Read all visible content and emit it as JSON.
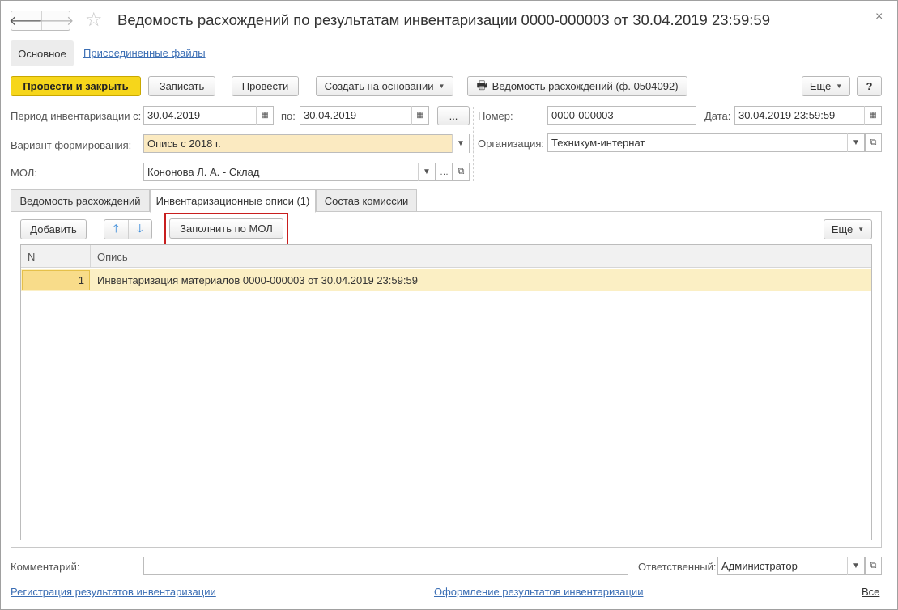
{
  "window": {
    "title": "Ведомость расхождений по результатам инвентаризации 0000-000003 от 30.04.2019 23:59:59",
    "close_glyph": "×"
  },
  "nav": {
    "back_glyph": "🡐",
    "forward_glyph": "🡒",
    "favorite_glyph": "☆"
  },
  "sections": {
    "main": "Основное",
    "files": "Присоединенные файлы"
  },
  "toolbar": {
    "post_close": "Провести и закрыть",
    "save": "Записать",
    "post": "Провести",
    "create_based": "Создать на основании",
    "print_icon": "🖶",
    "print_report": "Ведомость расхождений (ф. 0504092)",
    "more": "Еще",
    "help": "?"
  },
  "form": {
    "period_label": "Период инвентаризации с:",
    "period_from": "30.04.2019",
    "to_label": "по:",
    "period_to": "30.04.2019",
    "ellipsis": "...",
    "number_label": "Номер:",
    "number": "0000-000003",
    "date_label": "Дата:",
    "date": "30.04.2019 23:59:59",
    "variant_label": "Вариант формирования:",
    "variant": "Опись с 2018 г.",
    "org_label": "Организация:",
    "org": "Техникум-интернат",
    "mol_label": "МОЛ:",
    "mol": "Кононова Л. А. - Склад"
  },
  "tabs": [
    {
      "label": "Ведомость расхождений"
    },
    {
      "label": "Инвентаризационные описи (1)"
    },
    {
      "label": "Состав комиссии"
    }
  ],
  "tab_toolbar": {
    "add": "Добавить",
    "up_glyph": "🡑",
    "down_glyph": "🡓",
    "fill": "Заполнить по МОЛ",
    "more": "Еще"
  },
  "table": {
    "columns": [
      "N",
      "Опись"
    ],
    "rows": [
      {
        "n": "1",
        "op": "Инвентаризация материалов 0000-000003 от 30.04.2019 23:59:59"
      }
    ]
  },
  "footer": {
    "comment_label": "Комментарий:",
    "comment": "",
    "resp_label": "Ответственный:",
    "resp": "Администратор",
    "link_reg": "Регистрация результатов инвентаризации",
    "link_form": "Оформление результатов инвентаризации",
    "link_all": "Все"
  }
}
